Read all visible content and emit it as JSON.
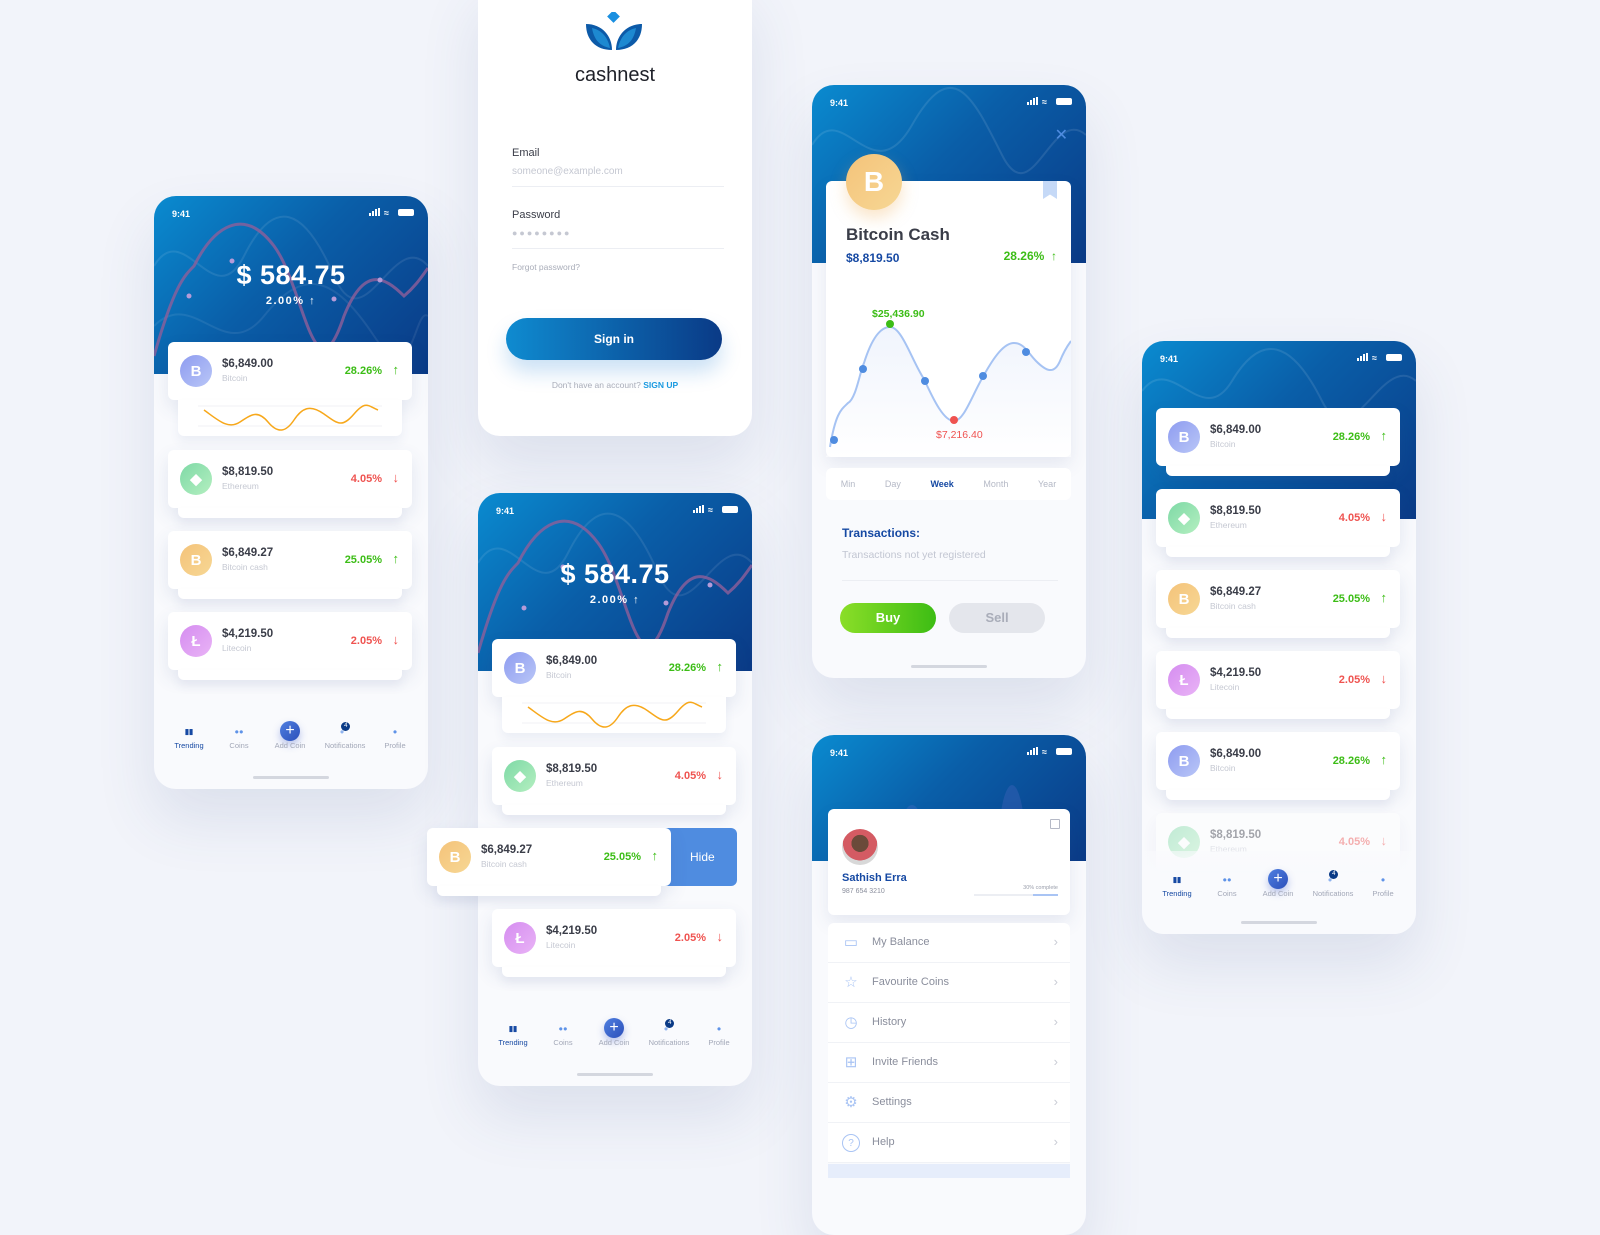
{
  "status": {
    "time": "9:41"
  },
  "portfolio": {
    "balance": "$ 584.75",
    "change": "2.00%",
    "change_arrow": "↑"
  },
  "coins": [
    {
      "price": "$6,849.00",
      "name": "Bitcoin",
      "change": "28.26%",
      "direction": "up",
      "arrow": "↑",
      "glyph": "B"
    },
    {
      "price": "$8,819.50",
      "name": "Ethereum",
      "change": "4.05%",
      "direction": "down",
      "arrow": "↓",
      "glyph": "◆"
    },
    {
      "price": "$6,849.27",
      "name": "Bitcoin cash",
      "change": "25.05%",
      "direction": "up",
      "arrow": "↑",
      "glyph": "B"
    },
    {
      "price": "$4,219.50",
      "name": "Litecoin",
      "change": "2.05%",
      "direction": "down",
      "arrow": "↓",
      "glyph": "Ł"
    }
  ],
  "nav": {
    "items": [
      {
        "label": "Trending",
        "icon": "bar-chart-icon",
        "active": true
      },
      {
        "label": "Coins",
        "icon": "coins-icon"
      },
      {
        "label": "Add Coin",
        "icon": "plus-icon"
      },
      {
        "label": "Notifications",
        "icon": "bell-icon",
        "badge": "4"
      },
      {
        "label": "Profile",
        "icon": "user-icon"
      }
    ]
  },
  "login": {
    "brand": "cashnest",
    "email_label": "Email",
    "email_placeholder": "someone@example.com",
    "password_label": "Password",
    "password_mask": "●●●●●●●●",
    "forgot": "Forgot password?",
    "signin": "Sign in",
    "no_account": "Don't have an account?",
    "signup": "SIGN UP"
  },
  "swipe": {
    "hide_label": "Hide"
  },
  "detail": {
    "coin_name": "Bitcoin Cash",
    "price": "$8,819.50",
    "change": "28.26%",
    "change_arrow": "↑",
    "high_label": "$25,436.90",
    "low_label": "$7,216.40",
    "timeframes": [
      "Min",
      "Day",
      "Week",
      "Month",
      "Year"
    ],
    "selected_timeframe": "Week",
    "transactions_title": "Transactions:",
    "transactions_empty": "Transactions not yet registered",
    "buy": "Buy",
    "sell": "Sell"
  },
  "profile": {
    "name": "Sathish Erra",
    "phone": "987 654 3210",
    "completion_label": "30% complete",
    "completion": 0.3,
    "menu": [
      {
        "label": "My Balance",
        "icon": "wallet-icon"
      },
      {
        "label": "Favourite Coins",
        "icon": "star-icon"
      },
      {
        "label": "History",
        "icon": "history-icon"
      },
      {
        "label": "Invite Friends",
        "icon": "gift-icon"
      },
      {
        "label": "Settings",
        "icon": "settings-icon"
      },
      {
        "label": "Help",
        "icon": "help-icon"
      }
    ]
  },
  "colors": {
    "accent": "#1649a3",
    "up": "#3cbd16",
    "down": "#ef5350",
    "hide": "#4f8ce0"
  }
}
